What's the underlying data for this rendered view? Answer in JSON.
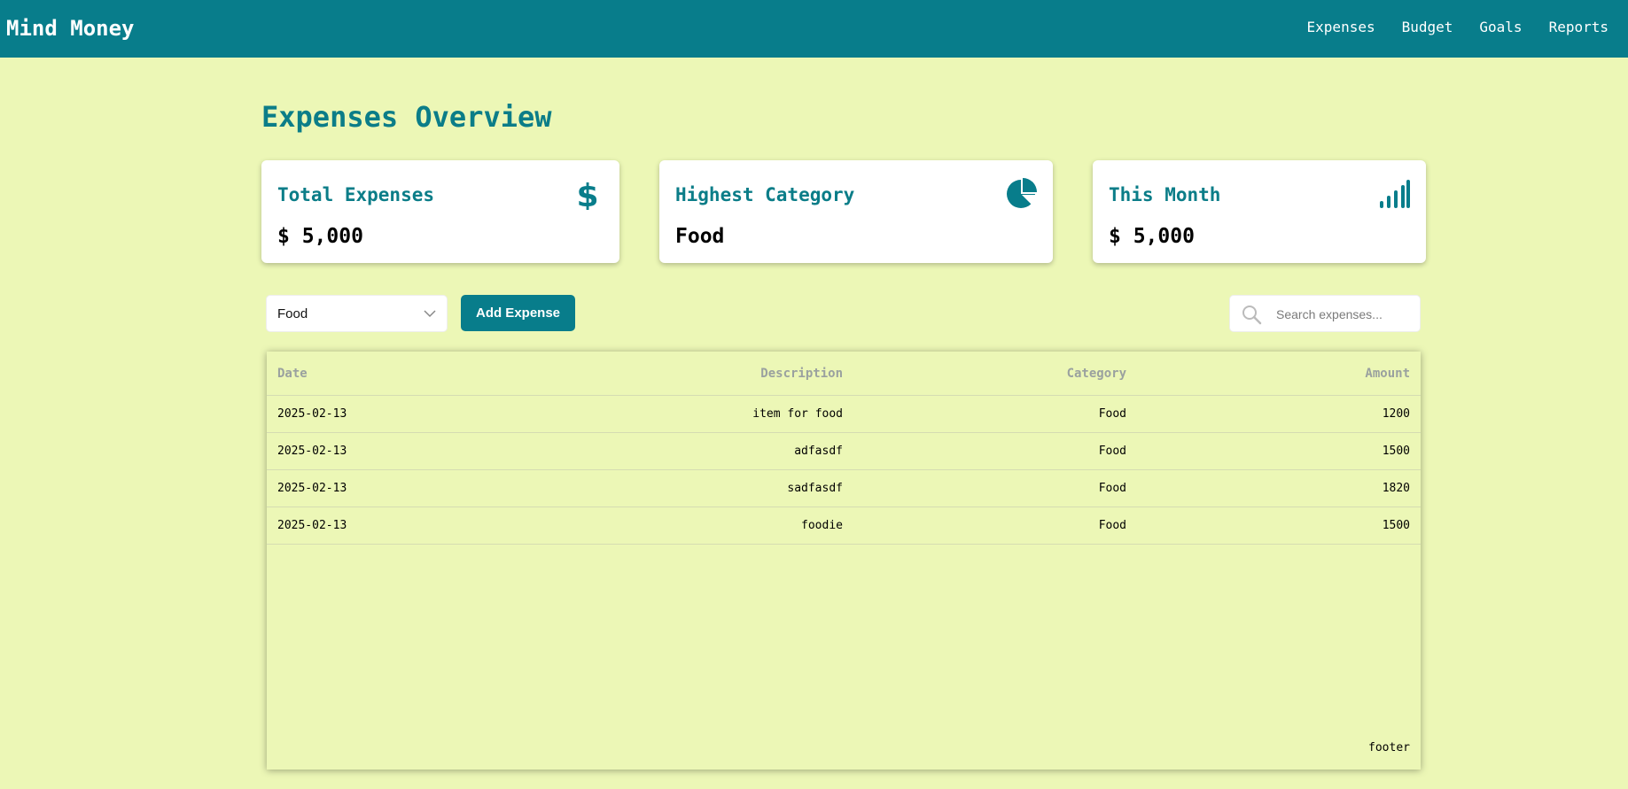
{
  "app": {
    "title": "Mind Money"
  },
  "nav": {
    "items": [
      "Expenses",
      "Budget",
      "Goals",
      "Reports"
    ]
  },
  "page": {
    "title": "Expenses Overview"
  },
  "cards": [
    {
      "title": "Total Expenses",
      "value": "$ 5,000",
      "icon": "dollar-icon"
    },
    {
      "title": "Highest Category",
      "value": "Food",
      "icon": "pie-chart-icon"
    },
    {
      "title": "This Month",
      "value": "$ 5,000",
      "icon": "signal-bars-icon"
    }
  ],
  "controls": {
    "category_selected": "Food",
    "add_button": "Add Expense",
    "search_placeholder": "Search expenses..."
  },
  "table": {
    "headers": [
      "Date",
      "Description",
      "Category",
      "Amount"
    ],
    "rows": [
      {
        "date": "2025-02-13",
        "description": "item for food",
        "category": "Food",
        "amount": "1200"
      },
      {
        "date": "2025-02-13",
        "description": "adfasdf",
        "category": "Food",
        "amount": "1500"
      },
      {
        "date": "2025-02-13",
        "description": "sadfasdf",
        "category": "Food",
        "amount": "1820"
      },
      {
        "date": "2025-02-13",
        "description": "foodie",
        "category": "Food",
        "amount": "1500"
      }
    ],
    "footer": "footer"
  },
  "colors": {
    "primary": "#087d8b",
    "background": "#ecf7b6",
    "card": "#ffffff",
    "header_text": "#9aa19f"
  }
}
